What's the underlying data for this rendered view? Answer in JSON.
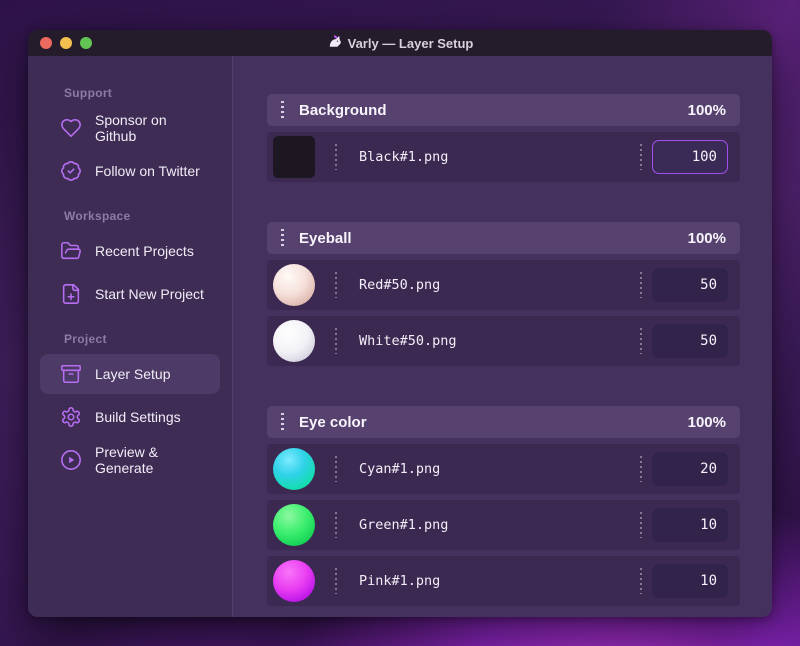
{
  "window": {
    "title": "Varly — Layer Setup",
    "titlebar_icon": "unicorn-icon",
    "traffic_lights": [
      "close",
      "minimize",
      "zoom"
    ]
  },
  "sidebar": {
    "sections": [
      {
        "label": "Support",
        "items": [
          {
            "icon": "heart-icon",
            "label": "Sponsor on Github"
          },
          {
            "icon": "badge-check-icon",
            "label": "Follow on Twitter"
          }
        ]
      },
      {
        "label": "Workspace",
        "items": [
          {
            "icon": "folder-open-icon",
            "label": "Recent Projects"
          },
          {
            "icon": "file-plus-icon",
            "label": "Start New Project"
          }
        ]
      },
      {
        "label": "Project",
        "items": [
          {
            "icon": "archive-icon",
            "label": "Layer Setup",
            "selected": true
          },
          {
            "icon": "gear-icon",
            "label": "Build Settings"
          },
          {
            "icon": "play-circle-icon",
            "label": "Preview & Generate"
          }
        ]
      }
    ]
  },
  "groups": [
    {
      "name": "Background",
      "opacity": "100%",
      "layers": [
        {
          "file": "Black#1.png",
          "value": "100",
          "thumb": "black-square",
          "focused": true
        }
      ]
    },
    {
      "name": "Eyeball",
      "opacity": "100%",
      "layers": [
        {
          "file": "Red#50.png",
          "value": "50",
          "thumb": "red-sphere"
        },
        {
          "file": "White#50.png",
          "value": "50",
          "thumb": "white-sphere"
        }
      ]
    },
    {
      "name": "Eye color",
      "opacity": "100%",
      "layers": [
        {
          "file": "Cyan#1.png",
          "value": "20",
          "thumb": "cyan-sphere"
        },
        {
          "file": "Green#1.png",
          "value": "10",
          "thumb": "green-sphere"
        },
        {
          "file": "Pink#1.png",
          "value": "10",
          "thumb": "pink-sphere"
        }
      ]
    }
  ],
  "colors": {
    "accent_icon": "#b76ef2",
    "focused_input_border": "#a64ff0",
    "window_bg": "#45315e",
    "sidebar_bg": "#3f2c55",
    "titlebar_bg": "#241b2b",
    "group_header_bg": "#57416f",
    "layer_row_bg": "#3c2951",
    "input_bg": "#32234b",
    "muted_label": "#8d7aa6",
    "text": "#f2eef8",
    "traffic_red": "#ed6a5e",
    "traffic_yellow": "#f5bf4f",
    "traffic_green": "#61c454",
    "thumb_black": "#1d1722",
    "thumb_red": "#f6e0da",
    "thumb_white": "#ffffff",
    "thumb_cyan": "#2fd2e8",
    "thumb_green": "#3bee6e",
    "thumb_pink": "#e93df2"
  }
}
